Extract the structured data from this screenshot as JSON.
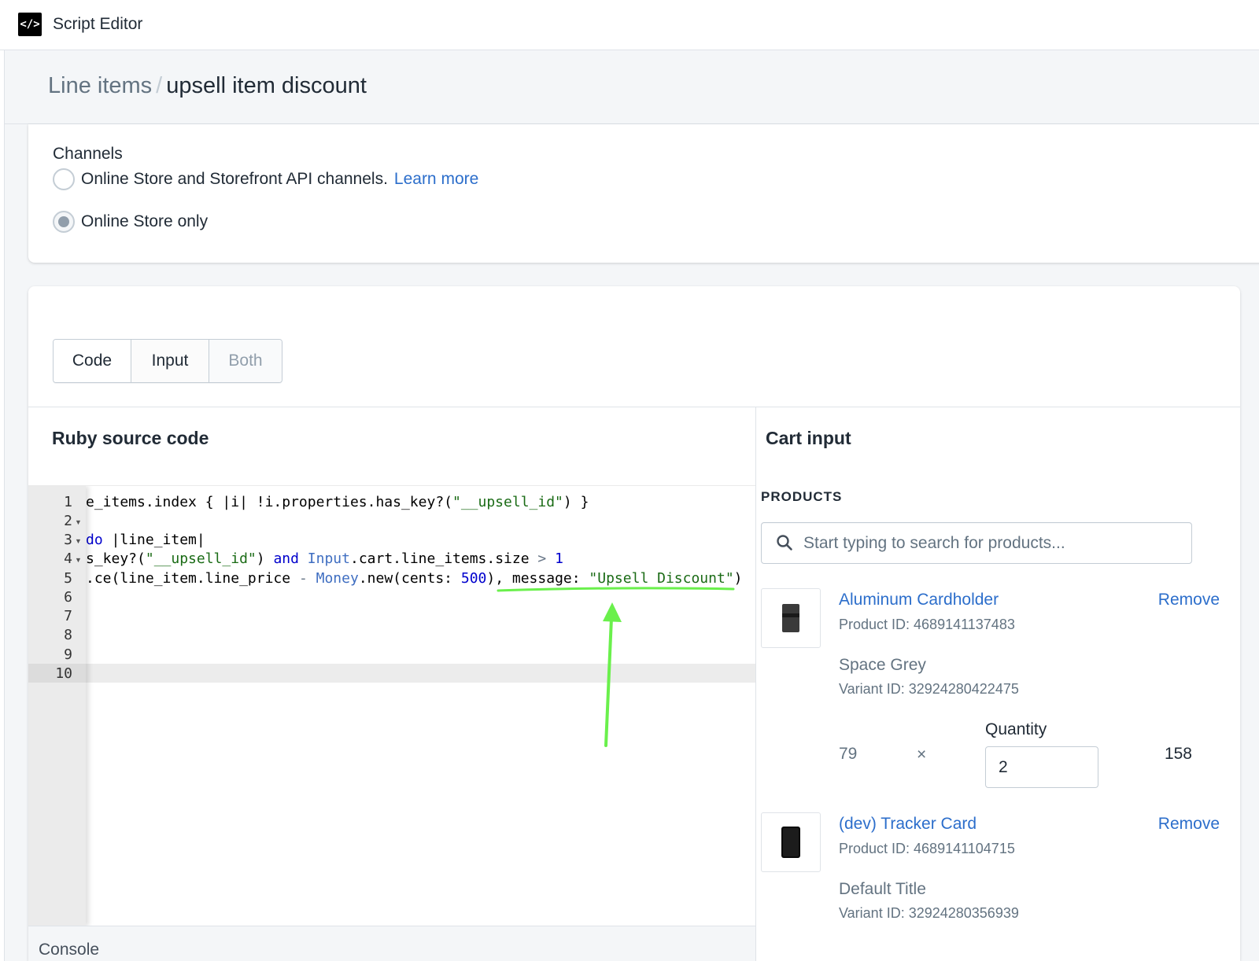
{
  "app": {
    "icon": "code-brackets-icon",
    "icon_glyph": "</>",
    "title": "Script Editor"
  },
  "breadcrumb": {
    "parent": "Line items",
    "separator": "/",
    "current": "upsell item discount"
  },
  "channels": {
    "title": "Channels",
    "options": [
      {
        "label": "Online Store and Storefront API channels.",
        "link": "Learn more",
        "selected": false
      },
      {
        "label": "Online Store only",
        "selected": true
      }
    ]
  },
  "view_toggle": {
    "options": [
      "Code",
      "Input",
      "Both"
    ],
    "disabled": "Both"
  },
  "editor": {
    "title": "Ruby source code",
    "line_numbers": [
      "1",
      "2",
      "3",
      "4",
      "5",
      "6",
      "7",
      "8",
      "9",
      "10"
    ],
    "foldable_lines": [
      2,
      3,
      4
    ],
    "active_line": 10,
    "lines": {
      "l1": {
        "a": "e_items.index { |i| !i.properties.has_key?(",
        "b": "\"__upsell_id\"",
        "c": ") }"
      },
      "l3": {
        "a": "do",
        "b": " |line_item|"
      },
      "l4": {
        "a": "s_key?(",
        "b": "\"__upsell_id\"",
        "c": ") ",
        "d": "and",
        "e": " ",
        "f": "Input",
        "g": ".cart.line_items.size ",
        "h": ">",
        "i": " ",
        "j": "1"
      },
      "l5": {
        "a": ".ce(line_item.line_price ",
        "b": "-",
        "c": " ",
        "d": "Money",
        "e": ".new(cents: ",
        "f": "500",
        "g": "), message: ",
        "h": "\"Upsell Discount\"",
        "i": ")"
      }
    },
    "annotation_color": "#6af04c",
    "console_label": "Console"
  },
  "cart": {
    "title": "Cart input",
    "products_label": "PRODUCTS",
    "search_placeholder": "Start typing to search for products...",
    "products": [
      {
        "name": "Aluminum Cardholder",
        "remove": "Remove",
        "product_id": "Product ID: 4689141137483",
        "variant": "Space Grey",
        "variant_id": "Variant ID: 32924280422475",
        "price": "79",
        "times": "×",
        "quantity_label": "Quantity",
        "quantity": "2",
        "line_total": "158"
      },
      {
        "name": "(dev) Tracker Card",
        "remove": "Remove",
        "product_id": "Product ID: 4689141104715",
        "variant": "Default Title",
        "variant_id": "Variant ID: 32924280356939"
      }
    ]
  },
  "colors": {
    "link": "#2c6ecb",
    "string": "#1a6b15",
    "keyword": "#0000cc",
    "constant": "#3f6ec1"
  }
}
